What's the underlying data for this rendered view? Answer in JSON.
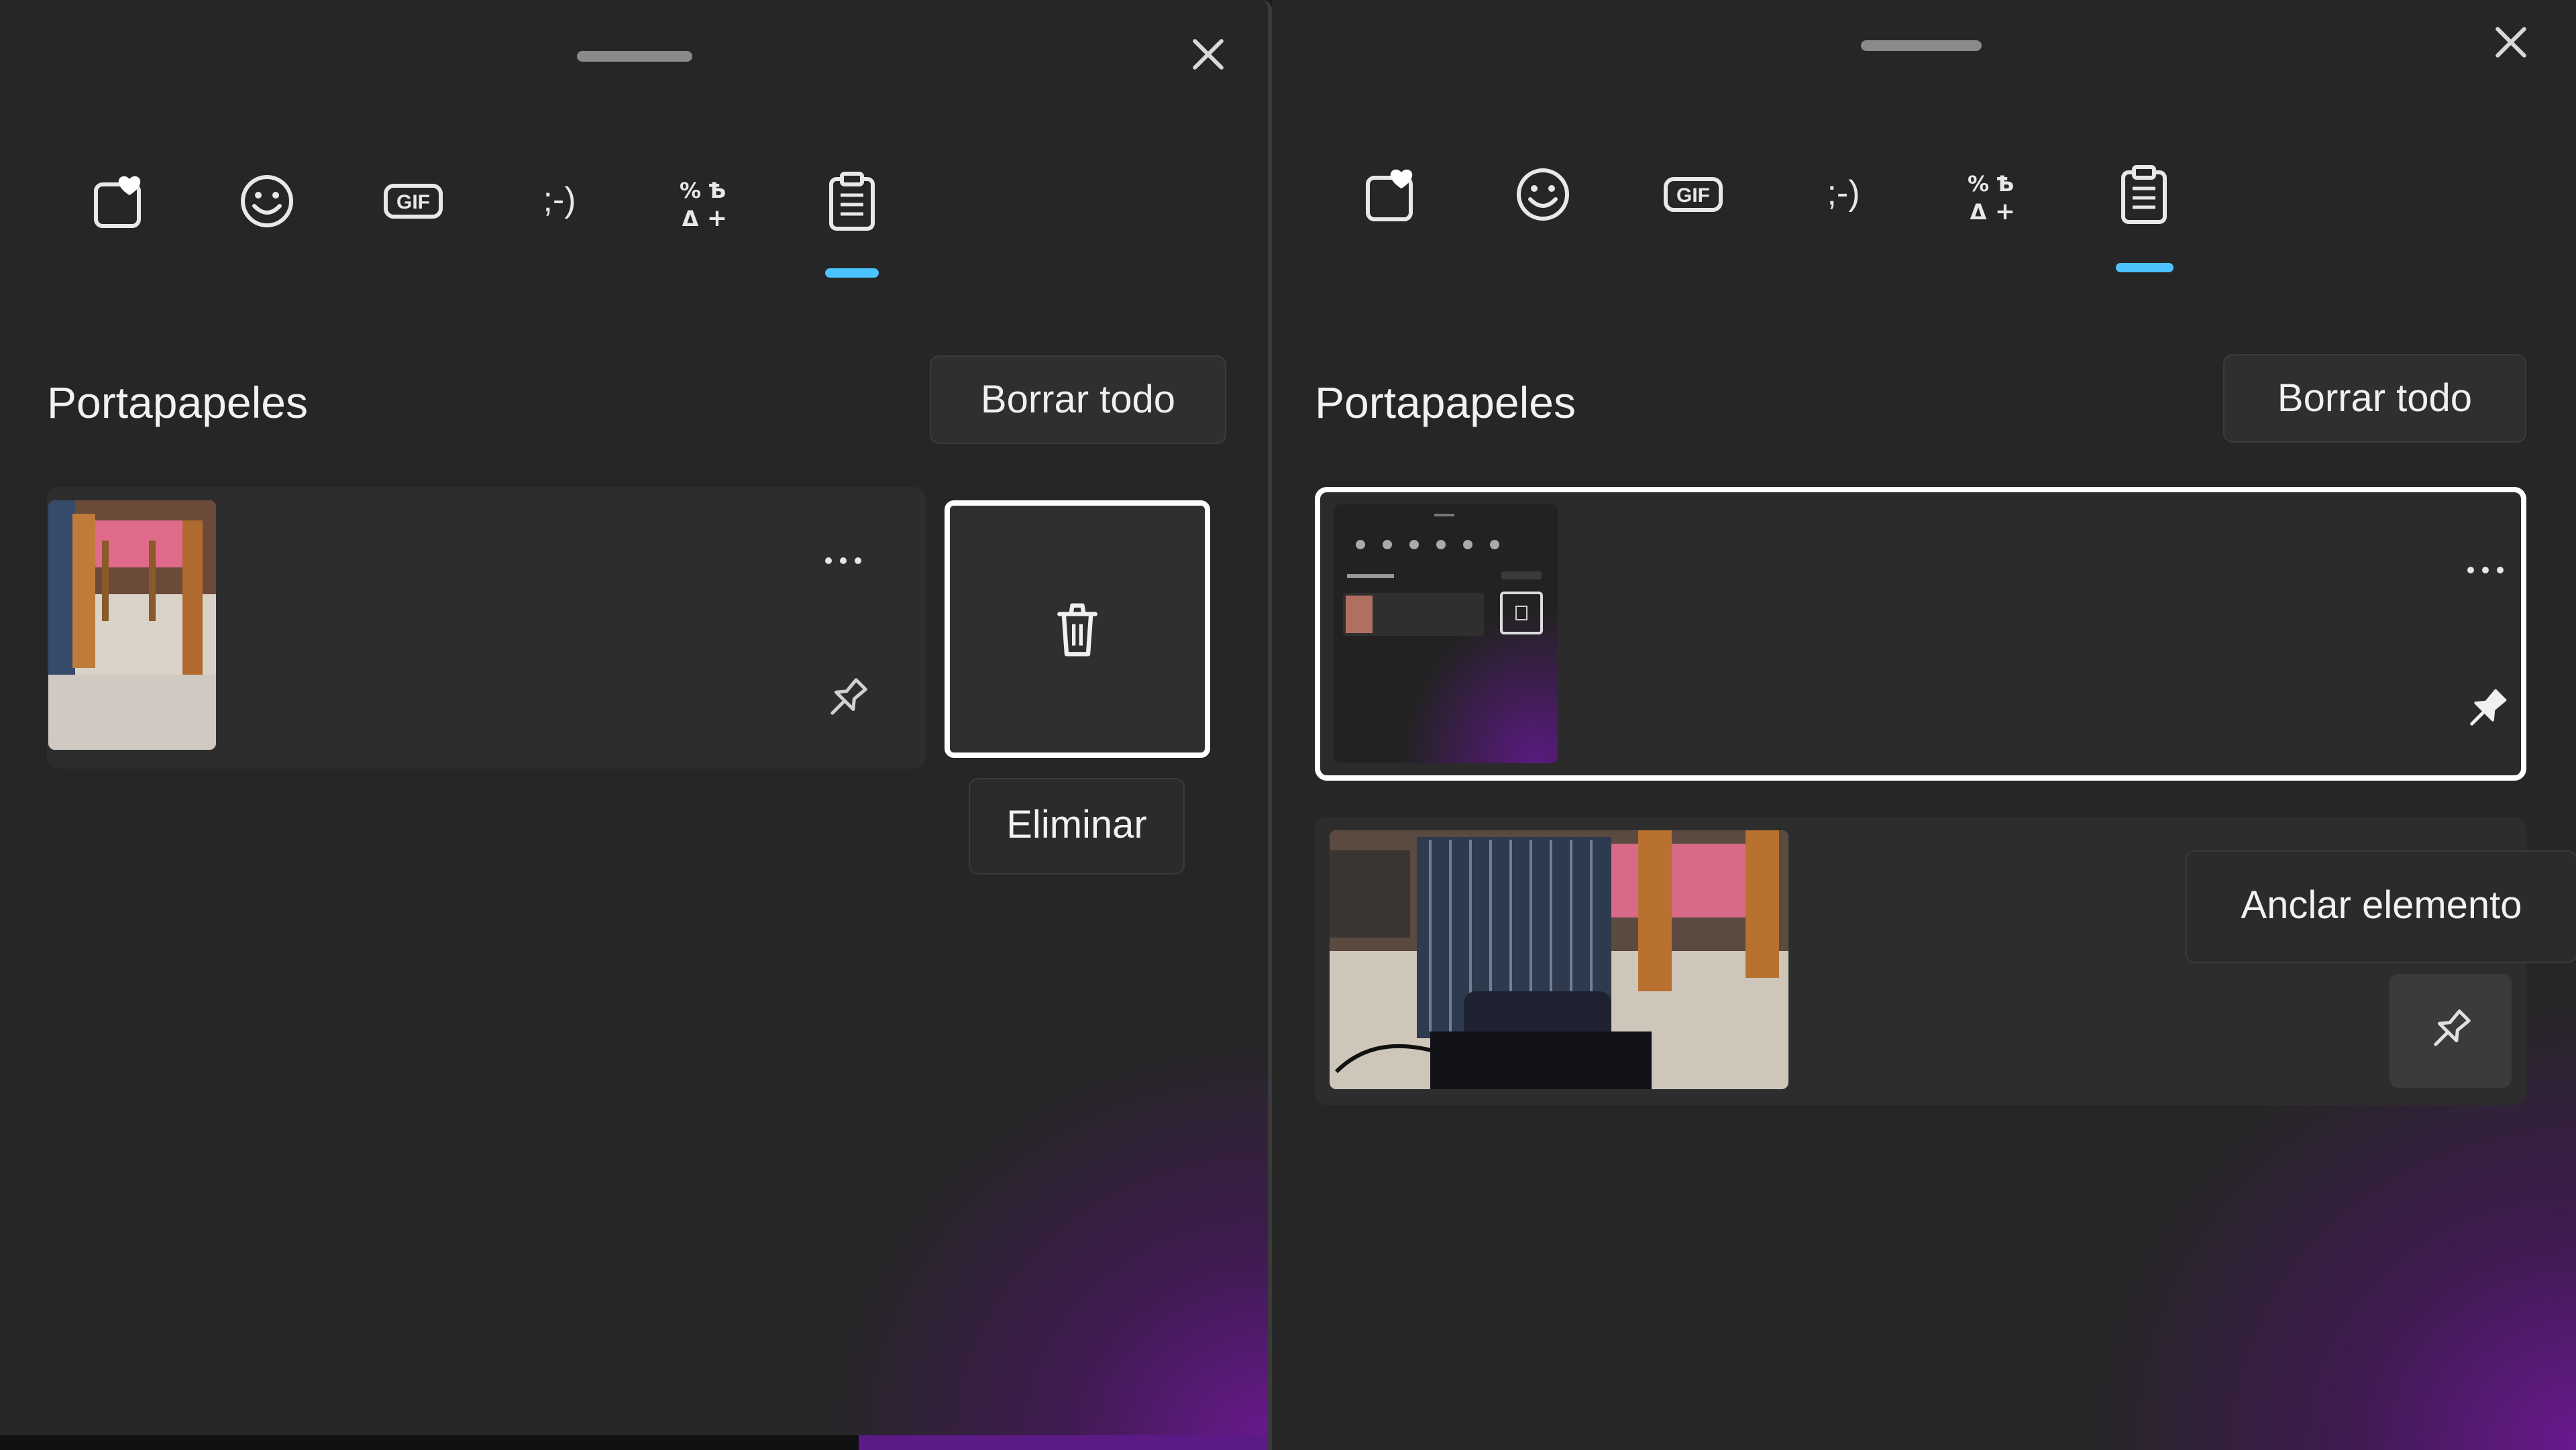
{
  "left_panel": {
    "tabs": [
      {
        "name": "favorites-icon",
        "label": ""
      },
      {
        "name": "emoji-icon",
        "label": ""
      },
      {
        "name": "gif-icon",
        "label": "GIF"
      },
      {
        "name": "kaomoji-icon",
        "label": ";-)"
      },
      {
        "name": "symbols-icon",
        "label": ""
      },
      {
        "name": "clipboard-icon",
        "label": ""
      }
    ],
    "title": "Portapapeles",
    "clear_button": "Borrar todo",
    "tooltip": "Eliminar"
  },
  "right_panel": {
    "tabs": [
      {
        "name": "favorites-icon",
        "label": ""
      },
      {
        "name": "emoji-icon",
        "label": ""
      },
      {
        "name": "gif-icon",
        "label": "GIF"
      },
      {
        "name": "kaomoji-icon",
        "label": ";-)"
      },
      {
        "name": "symbols-icon",
        "label": ""
      },
      {
        "name": "clipboard-icon",
        "label": ""
      }
    ],
    "title": "Portapapeles",
    "clear_button": "Borrar todo",
    "tooltip": "Anclar elemento"
  },
  "colors": {
    "accent": "#4cc2ff",
    "panel_bg": "#262626",
    "item_bg": "#2d2d2d",
    "glow": "#6e1896"
  }
}
